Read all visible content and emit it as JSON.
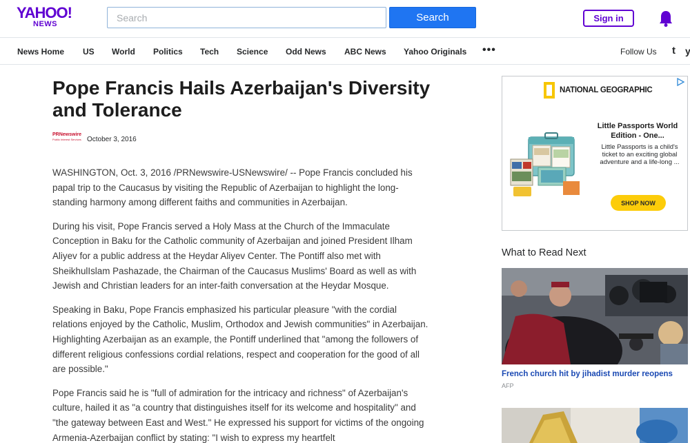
{
  "header": {
    "logo_main": "YAHOO!",
    "logo_sub": "NEWS",
    "search_placeholder": "Search",
    "search_button": "Search",
    "sign_in": "Sign in"
  },
  "nav": {
    "items": [
      "News Home",
      "US",
      "World",
      "Politics",
      "Tech",
      "Science",
      "Odd News",
      "ABC News",
      "Yahoo Originals"
    ],
    "more": "•••",
    "follow_label": "Follow Us",
    "social": [
      "t",
      "y"
    ]
  },
  "article": {
    "title": "Pope Francis Hails Azerbaijan's Diversity and Tolerance",
    "source_logo_top": "PRNewswire",
    "source_logo_bottom": "Public Interest Services",
    "date": "October 3, 2016",
    "paragraphs": [
      "WASHINGTON, Oct. 3, 2016 /PRNewswire-USNewswire/ -- Pope Francis concluded his papal trip to the Caucasus by visiting the Republic of Azerbaijan to highlight the long-standing harmony among different faiths and communities in Azerbaijan.",
      "During his visit, Pope Francis served a Holy Mass at the Church of the Immaculate Conception in Baku for the Catholic community of Azerbaijan and joined President Ilham Aliyev for a public address at the Heydar Aliyev Center. The Pontiff also met with SheikhulIslam Pashazade, the Chairman of the Caucasus Muslims' Board as well as with Jewish and Christian leaders for an inter-faith conversation at the Heydar Mosque.",
      "Speaking in Baku, Pope Francis emphasized his particular pleasure \"with the cordial relations enjoyed by the Catholic, Muslim, Orthodox and Jewish communities\" in Azerbaijan. Highlighting Azerbaijan as an example, the Pontiff underlined that \"among the followers of different religious confessions cordial relations, respect and cooperation for the good of all are possible.\"",
      "Pope Francis said he is \"full of admiration for the intricacy and richness\" of Azerbaijan's culture, hailed it as \"a country that distinguishes itself for its welcome and hospitality\" and \"the gateway between East and West.\" He expressed his support for victims of the ongoing Armenia-Azerbaijan conflict by stating: \"I wish to express my heartfelt"
    ]
  },
  "ad": {
    "brand": "NATIONAL GEOGRAPHIC",
    "headline": "Little Passports World Edition - One...",
    "description": "Little Passports is a child's ticket to an exciting global adventure and a life-long ...",
    "cta": "SHOP NOW",
    "brand_color": "#f7c600"
  },
  "sidebar": {
    "heading": "What to Read Next",
    "stories": [
      {
        "title": "French church hit by jihadist murder reopens",
        "source": "AFP"
      }
    ]
  },
  "colors": {
    "brand_purple": "#6001d2",
    "search_blue": "#1f75f2",
    "link_blue": "#1a49b3"
  }
}
